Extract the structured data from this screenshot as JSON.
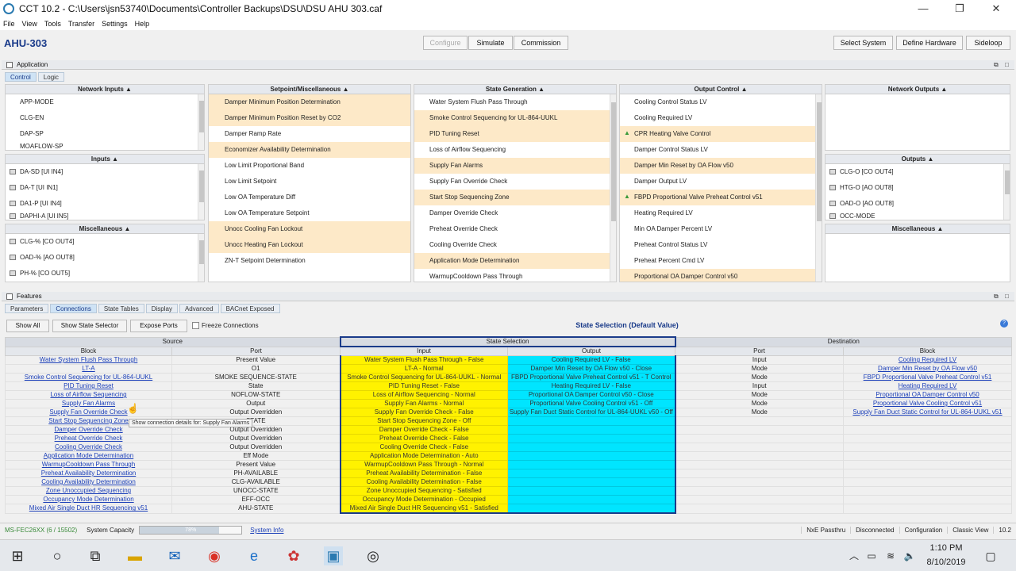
{
  "window": {
    "title": "CCT 10.2 - C:\\Users\\jsn53740\\Documents\\Controller Backups\\DSU\\DSU AHU 303.caf",
    "min": "—",
    "max": "❐",
    "close": "✕"
  },
  "menu": [
    "File",
    "View",
    "Tools",
    "Transfer",
    "Settings",
    "Help"
  ],
  "toolbar": {
    "device": "AHU-303",
    "configure": "Configure",
    "simulate": "Simulate",
    "commission": "Commission",
    "select_system": "Select System",
    "define_hardware": "Define Hardware",
    "sideloop": "Sideloop"
  },
  "application": {
    "title": "Application",
    "tabs": [
      "Control",
      "Logic"
    ],
    "network_inputs": {
      "header": "Network Inputs ▲",
      "items": [
        "APP-MODE",
        "CLG-EN",
        "DAP-SP",
        "MOAFLOW-SP"
      ]
    },
    "inputs": {
      "header": "Inputs ▲",
      "items": [
        "DA-SD [UI IN4]",
        "DA-T [UI IN1]",
        "DA1-P [UI IN4]",
        "DAPHI-A [UI IN5]"
      ]
    },
    "misc_left": {
      "header": "Miscellaneous ▲",
      "items": [
        "CLG-% [CO OUT4]",
        "OAD-% [AO OUT8]",
        "PH-% [CO OUT5]"
      ]
    },
    "setpoint": {
      "header": "Setpoint/Miscellaneous ▲",
      "items": [
        "Damper Minimum Position Determination",
        "Damper Minimum Position Reset by CO2",
        "Damper Ramp Rate",
        "Economizer Availability Determination",
        "Low Limit Proportional Band",
        "Low Limit Setpoint",
        "Low OA Temperature Diff",
        "Low OA Temperature Setpoint",
        "Unocc Cooling Fan Lockout",
        "Unocc Heating Fan Lockout",
        "ZN-T Setpoint Determination"
      ]
    },
    "state_gen": {
      "header": "State Generation ▲",
      "items": [
        "Water System Flush Pass Through",
        "Smoke Control Sequencing for UL-864-UUKL",
        "PID Tuning Reset",
        "Loss of Airflow Sequencing",
        "Supply Fan Alarms",
        "Supply Fan Override Check",
        "Start Stop Sequencing Zone",
        "Damper Override Check",
        "Preheat Override Check",
        "Cooling Override Check",
        "Application Mode Determination",
        "WarmupCooldown Pass Through"
      ]
    },
    "output_ctrl": {
      "header": "Output Control ▲",
      "items": [
        "Cooling Control Status LV",
        "Cooling Required LV",
        "CPR Heating Valve Control",
        "Damper Control Status LV",
        "Damper Min Reset by OA Flow v50",
        "Damper Output LV",
        "FBPD Proportional Valve Preheat Control v51",
        "Heating Required LV",
        "Min OA Damper Percent LV",
        "Preheat Control Status LV",
        "Preheat Percent Cmd LV",
        "Proportional OA Damper Control v50"
      ]
    },
    "network_outputs": {
      "header": "Network Outputs ▲"
    },
    "outputs": {
      "header": "Outputs ▲",
      "items": [
        "CLG-O [CO OUT4]",
        "HTG-O [AO OUT8]",
        "OAD-O [AO OUT8]",
        "OCC-MODE"
      ]
    },
    "misc_right": {
      "header": "Miscellaneous ▲"
    }
  },
  "features": {
    "title": "Features",
    "tabs": [
      "Parameters",
      "Connections",
      "State Tables",
      "Display",
      "Advanced",
      "BACnet Exposed"
    ],
    "show_all": "Show All",
    "show_state_selector": "Show State Selector",
    "expose_ports": "Expose Ports",
    "freeze": "Freeze Connections",
    "state_selection_title": "State Selection (Default Value)",
    "groups": {
      "source": "Source",
      "state_selection": "State Selection",
      "destination": "Destination"
    },
    "cols": [
      "Block",
      "Port",
      "Input",
      "Output",
      "Port",
      "Block"
    ],
    "rows": [
      [
        "Water System Flush Pass Through",
        "Present Value",
        "Water System Flush Pass Through - False",
        "Cooling Required LV - False",
        "Input",
        "Cooling Required LV"
      ],
      [
        "LT-A",
        "O1",
        "LT-A - Normal",
        "Damper Min Reset by OA Flow v50 - Close",
        "Mode",
        "Damper Min Reset by OA Flow v50"
      ],
      [
        "Smoke Control Sequencing for UL-864-UUKL",
        "SMOKE SEQUENCE-STATE",
        "Smoke Control Sequencing for UL-864-UUKL - Normal",
        "FBPD Proportional Valve Preheat Control v51 - T Control",
        "Mode",
        "FBPD Proportional Valve Preheat Control v51"
      ],
      [
        "PID Tuning Reset",
        "State",
        "PID Tuning Reset - False",
        "Heating Required LV - False",
        "Input",
        "Heating Required LV"
      ],
      [
        "Loss of Airflow Sequencing",
        "NOFLOW-STATE",
        "Loss of Airflow Sequencing - Normal",
        "Proportional OA Damper Control v50 - Close",
        "Mode",
        "Proportional OA Damper Control v50"
      ],
      [
        "Supply Fan Alarms",
        "Output",
        "Supply Fan Alarms - Normal",
        "Proportional Valve Cooling Control v51 - Off",
        "Mode",
        "Proportional Valve Cooling Control v51"
      ],
      [
        "Supply Fan Override Check",
        "Output Overridden",
        "Supply Fan Override Check - False",
        "Supply Fan Duct Static Control for UL-864-UUKL v50 - Off",
        "Mode",
        "Supply Fan Duct Static Control for UL-864-UUKL v51"
      ],
      [
        "Start Stop Sequencing Zone",
        "STATE",
        "Start Stop Sequencing Zone - Off",
        "",
        "",
        ""
      ],
      [
        "Damper Override Check",
        "Output Overridden",
        "Damper Override Check - False",
        "",
        "",
        ""
      ],
      [
        "Preheat Override Check",
        "Output Overridden",
        "Preheat Override Check - False",
        "",
        "",
        ""
      ],
      [
        "Cooling Override Check",
        "Output Overridden",
        "Cooling Override Check - False",
        "",
        "",
        ""
      ],
      [
        "Application Mode Determination",
        "Eff Mode",
        "Application Mode Determination - Auto",
        "",
        "",
        ""
      ],
      [
        "WarmupCooldown Pass Through",
        "Present Value",
        "WarmupCooldown Pass Through - Normal",
        "",
        "",
        ""
      ],
      [
        "Preheat Availability Determination",
        "PH-AVAILABLE",
        "Preheat Availability Determination - False",
        "",
        "",
        ""
      ],
      [
        "Cooling Availability Determination",
        "CLG-AVAILABLE",
        "Cooling Availability Determination - False",
        "",
        "",
        ""
      ],
      [
        "Zone Unoccupied Sequencing",
        "UNOCC-STATE",
        "Zone Unoccupied Sequencing - Satisfied",
        "",
        "",
        ""
      ],
      [
        "Occupancy Mode Determination",
        "EFF-OCC",
        "Occupancy Mode Determination - Occupied",
        "",
        "",
        ""
      ],
      [
        "Mixed Air Single Duct HR Sequencing v51",
        "AHU-STATE",
        "Mixed Air Single Duct HR Sequencing v51 - Satisfied",
        "",
        "",
        ""
      ]
    ],
    "tooltip": "Show connection details for: Supply Fan Alarms"
  },
  "status": {
    "device": "MS-FEC26XX (6 / 15502)",
    "capacity_label": "System Capacity",
    "capacity_pct": "78%",
    "capacity_value": 0.78,
    "system_info": "System Info",
    "right": [
      "NxE Passthru",
      "Disconnected",
      "Configuration",
      "Classic View",
      "10.2"
    ]
  },
  "taskbar": {
    "time": "1:10 PM",
    "date": "8/10/2019",
    "colors": {
      "accent": "#1a3b8a",
      "highlight": "#fde9c8",
      "yellow": "#fff200",
      "cyan": "#00e5ff"
    }
  }
}
